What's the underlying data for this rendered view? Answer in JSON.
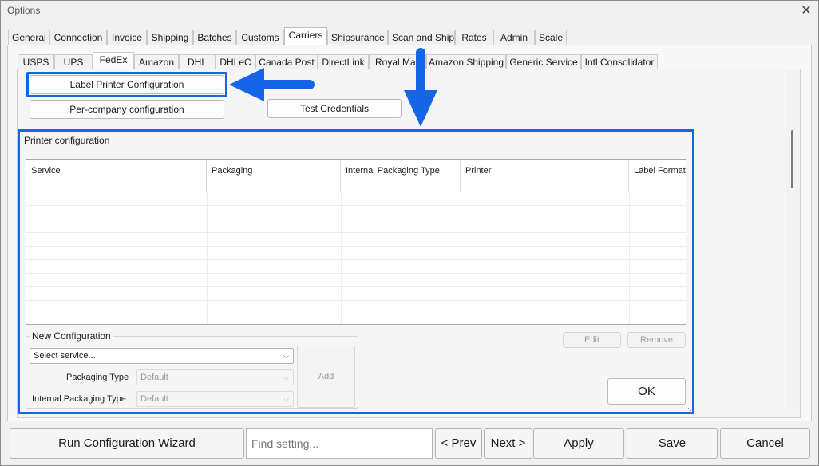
{
  "window": {
    "title": "Options",
    "close_glyph": "✕"
  },
  "main_tabs": [
    "General",
    "Connection",
    "Invoice",
    "Shipping",
    "Batches",
    "Customs",
    "Carriers",
    "Shipsurance",
    "Scan and Ship",
    "Rates",
    "Admin",
    "Scale"
  ],
  "main_tabs_active": "Carriers",
  "carrier_tabs": [
    "USPS",
    "UPS",
    "FedEx",
    "Amazon",
    "DHL",
    "DHLeC",
    "Canada Post",
    "DirectLink",
    "Royal Mail",
    "Amazon Shipping",
    "Generic Service",
    "Intl Consolidator"
  ],
  "carrier_tabs_active": "FedEx",
  "buttons": {
    "label_printer_config": "Label Printer Configuration",
    "per_company_config": "Per-company configuration",
    "test_credentials": "Test Credentials",
    "edit": "Edit",
    "remove": "Remove",
    "add": "Add",
    "ok": "OK"
  },
  "printer_config": {
    "heading": "Printer configuration",
    "columns": [
      "Service",
      "Packaging",
      "Internal Packaging Type",
      "Printer",
      "Label Format"
    ]
  },
  "new_config": {
    "legend": "New Configuration",
    "service_value": "Select service...",
    "packaging_type_label": "Packaging Type",
    "packaging_type_value": "Default",
    "internal_packaging_type_label": "Internal Packaging Type",
    "internal_packaging_type_value": "Default"
  },
  "footer": {
    "wizard": "Run Configuration Wizard",
    "find_placeholder": "Find setting...",
    "prev": "< Prev",
    "next": "Next >",
    "apply": "Apply",
    "save": "Save",
    "cancel": "Cancel"
  },
  "icons": {
    "dropdown": "chevron-down-icon",
    "close": "close-icon"
  },
  "colors": {
    "highlight": "#1565e6"
  }
}
